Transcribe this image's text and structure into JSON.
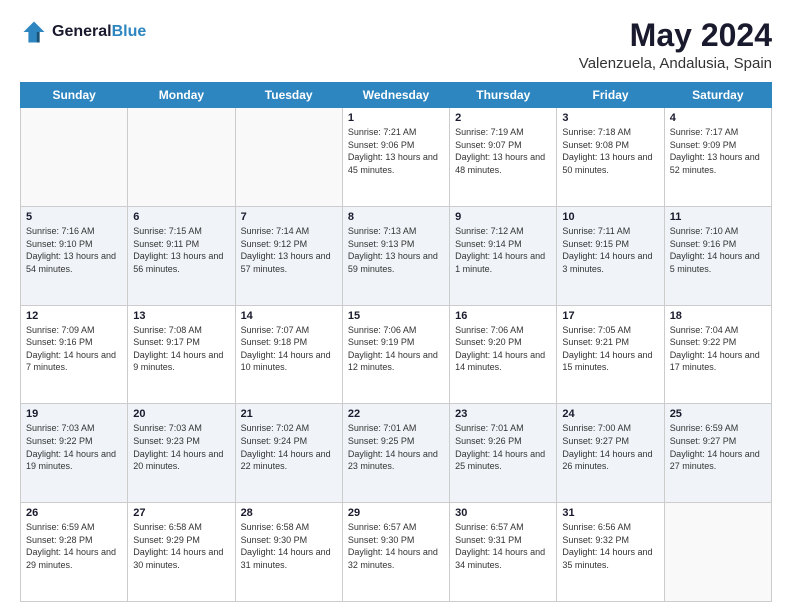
{
  "header": {
    "logo_general": "General",
    "logo_blue": "Blue",
    "title": "May 2024",
    "subtitle": "Valenzuela, Andalusia, Spain"
  },
  "days_of_week": [
    "Sunday",
    "Monday",
    "Tuesday",
    "Wednesday",
    "Thursday",
    "Friday",
    "Saturday"
  ],
  "weeks": [
    [
      {
        "day": "",
        "sunrise": "",
        "sunset": "",
        "daylight": ""
      },
      {
        "day": "",
        "sunrise": "",
        "sunset": "",
        "daylight": ""
      },
      {
        "day": "",
        "sunrise": "",
        "sunset": "",
        "daylight": ""
      },
      {
        "day": "1",
        "sunrise": "Sunrise: 7:21 AM",
        "sunset": "Sunset: 9:06 PM",
        "daylight": "Daylight: 13 hours and 45 minutes."
      },
      {
        "day": "2",
        "sunrise": "Sunrise: 7:19 AM",
        "sunset": "Sunset: 9:07 PM",
        "daylight": "Daylight: 13 hours and 48 minutes."
      },
      {
        "day": "3",
        "sunrise": "Sunrise: 7:18 AM",
        "sunset": "Sunset: 9:08 PM",
        "daylight": "Daylight: 13 hours and 50 minutes."
      },
      {
        "day": "4",
        "sunrise": "Sunrise: 7:17 AM",
        "sunset": "Sunset: 9:09 PM",
        "daylight": "Daylight: 13 hours and 52 minutes."
      }
    ],
    [
      {
        "day": "5",
        "sunrise": "Sunrise: 7:16 AM",
        "sunset": "Sunset: 9:10 PM",
        "daylight": "Daylight: 13 hours and 54 minutes."
      },
      {
        "day": "6",
        "sunrise": "Sunrise: 7:15 AM",
        "sunset": "Sunset: 9:11 PM",
        "daylight": "Daylight: 13 hours and 56 minutes."
      },
      {
        "day": "7",
        "sunrise": "Sunrise: 7:14 AM",
        "sunset": "Sunset: 9:12 PM",
        "daylight": "Daylight: 13 hours and 57 minutes."
      },
      {
        "day": "8",
        "sunrise": "Sunrise: 7:13 AM",
        "sunset": "Sunset: 9:13 PM",
        "daylight": "Daylight: 13 hours and 59 minutes."
      },
      {
        "day": "9",
        "sunrise": "Sunrise: 7:12 AM",
        "sunset": "Sunset: 9:14 PM",
        "daylight": "Daylight: 14 hours and 1 minute."
      },
      {
        "day": "10",
        "sunrise": "Sunrise: 7:11 AM",
        "sunset": "Sunset: 9:15 PM",
        "daylight": "Daylight: 14 hours and 3 minutes."
      },
      {
        "day": "11",
        "sunrise": "Sunrise: 7:10 AM",
        "sunset": "Sunset: 9:16 PM",
        "daylight": "Daylight: 14 hours and 5 minutes."
      }
    ],
    [
      {
        "day": "12",
        "sunrise": "Sunrise: 7:09 AM",
        "sunset": "Sunset: 9:16 PM",
        "daylight": "Daylight: 14 hours and 7 minutes."
      },
      {
        "day": "13",
        "sunrise": "Sunrise: 7:08 AM",
        "sunset": "Sunset: 9:17 PM",
        "daylight": "Daylight: 14 hours and 9 minutes."
      },
      {
        "day": "14",
        "sunrise": "Sunrise: 7:07 AM",
        "sunset": "Sunset: 9:18 PM",
        "daylight": "Daylight: 14 hours and 10 minutes."
      },
      {
        "day": "15",
        "sunrise": "Sunrise: 7:06 AM",
        "sunset": "Sunset: 9:19 PM",
        "daylight": "Daylight: 14 hours and 12 minutes."
      },
      {
        "day": "16",
        "sunrise": "Sunrise: 7:06 AM",
        "sunset": "Sunset: 9:20 PM",
        "daylight": "Daylight: 14 hours and 14 minutes."
      },
      {
        "day": "17",
        "sunrise": "Sunrise: 7:05 AM",
        "sunset": "Sunset: 9:21 PM",
        "daylight": "Daylight: 14 hours and 15 minutes."
      },
      {
        "day": "18",
        "sunrise": "Sunrise: 7:04 AM",
        "sunset": "Sunset: 9:22 PM",
        "daylight": "Daylight: 14 hours and 17 minutes."
      }
    ],
    [
      {
        "day": "19",
        "sunrise": "Sunrise: 7:03 AM",
        "sunset": "Sunset: 9:22 PM",
        "daylight": "Daylight: 14 hours and 19 minutes."
      },
      {
        "day": "20",
        "sunrise": "Sunrise: 7:03 AM",
        "sunset": "Sunset: 9:23 PM",
        "daylight": "Daylight: 14 hours and 20 minutes."
      },
      {
        "day": "21",
        "sunrise": "Sunrise: 7:02 AM",
        "sunset": "Sunset: 9:24 PM",
        "daylight": "Daylight: 14 hours and 22 minutes."
      },
      {
        "day": "22",
        "sunrise": "Sunrise: 7:01 AM",
        "sunset": "Sunset: 9:25 PM",
        "daylight": "Daylight: 14 hours and 23 minutes."
      },
      {
        "day": "23",
        "sunrise": "Sunrise: 7:01 AM",
        "sunset": "Sunset: 9:26 PM",
        "daylight": "Daylight: 14 hours and 25 minutes."
      },
      {
        "day": "24",
        "sunrise": "Sunrise: 7:00 AM",
        "sunset": "Sunset: 9:27 PM",
        "daylight": "Daylight: 14 hours and 26 minutes."
      },
      {
        "day": "25",
        "sunrise": "Sunrise: 6:59 AM",
        "sunset": "Sunset: 9:27 PM",
        "daylight": "Daylight: 14 hours and 27 minutes."
      }
    ],
    [
      {
        "day": "26",
        "sunrise": "Sunrise: 6:59 AM",
        "sunset": "Sunset: 9:28 PM",
        "daylight": "Daylight: 14 hours and 29 minutes."
      },
      {
        "day": "27",
        "sunrise": "Sunrise: 6:58 AM",
        "sunset": "Sunset: 9:29 PM",
        "daylight": "Daylight: 14 hours and 30 minutes."
      },
      {
        "day": "28",
        "sunrise": "Sunrise: 6:58 AM",
        "sunset": "Sunset: 9:30 PM",
        "daylight": "Daylight: 14 hours and 31 minutes."
      },
      {
        "day": "29",
        "sunrise": "Sunrise: 6:57 AM",
        "sunset": "Sunset: 9:30 PM",
        "daylight": "Daylight: 14 hours and 32 minutes."
      },
      {
        "day": "30",
        "sunrise": "Sunrise: 6:57 AM",
        "sunset": "Sunset: 9:31 PM",
        "daylight": "Daylight: 14 hours and 34 minutes."
      },
      {
        "day": "31",
        "sunrise": "Sunrise: 6:56 AM",
        "sunset": "Sunset: 9:32 PM",
        "daylight": "Daylight: 14 hours and 35 minutes."
      },
      {
        "day": "",
        "sunrise": "",
        "sunset": "",
        "daylight": ""
      }
    ]
  ]
}
